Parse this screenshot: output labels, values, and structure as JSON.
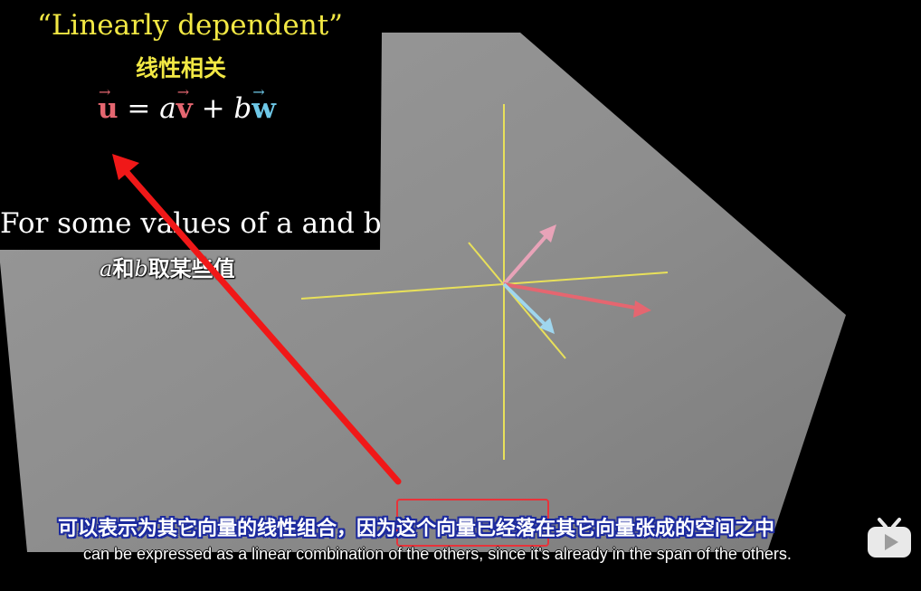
{
  "overlay": {
    "title": "“Linearly dependent”",
    "title_cn": "线性相关",
    "equation": {
      "u": "u",
      "equals": " = ",
      "a": "a",
      "v": "v",
      "plus": " + ",
      "b": "b",
      "w": "w",
      "arrow": "→"
    },
    "values_text": "For some values of a and b",
    "values_cn_a": "a",
    "values_cn_mid": "和",
    "values_cn_b": "b",
    "values_cn_end": "取某些值"
  },
  "subtitles": {
    "chinese": "可以表示为其它向量的线性组合，因为这个向量已经落在其它向量张成的空间之中",
    "english": "can be expressed as a linear combination of the others, since it's already in the span of the others."
  },
  "colors": {
    "title_yellow": "#f2e844",
    "vector_u": "#e56670",
    "vector_v": "#e56670",
    "vector_w": "#6ec8e8",
    "annotation_red": "#f01818",
    "plane_gray": "#8a8a8a",
    "axis_yellow": "#e8e05a"
  },
  "icons": {
    "watermark": "bilibili-tv-icon"
  }
}
